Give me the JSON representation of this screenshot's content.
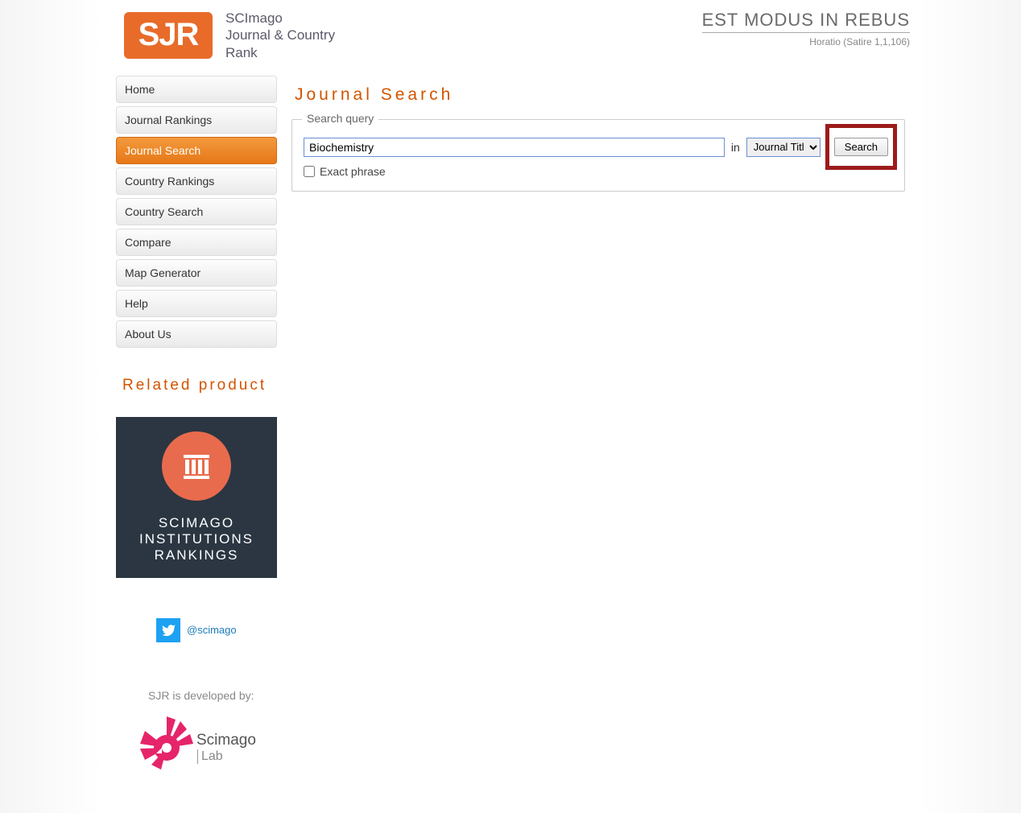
{
  "header": {
    "logo_abbr": "SJR",
    "logo_line1": "SCImago",
    "logo_line2": "Journal & Country",
    "logo_line3": "Rank",
    "motto": "EST MODUS IN REBUS",
    "motto_sub": "Horatio (Satire 1,1,106)"
  },
  "sidebar": {
    "items": [
      {
        "label": "Home",
        "active": false
      },
      {
        "label": "Journal Rankings",
        "active": false
      },
      {
        "label": "Journal Search",
        "active": true
      },
      {
        "label": "Country Rankings",
        "active": false
      },
      {
        "label": "Country Search",
        "active": false
      },
      {
        "label": "Compare",
        "active": false
      },
      {
        "label": "Map Generator",
        "active": false
      },
      {
        "label": "Help",
        "active": false
      },
      {
        "label": "About Us",
        "active": false
      }
    ],
    "related_title": "Related product",
    "promo_line1": "SCIMAGO",
    "promo_line2": "INSTITUTIONS",
    "promo_line3": "RANKINGS",
    "twitter_handle": "@scimago",
    "dev_by": "SJR is developed by:",
    "lab_name": "Scimago",
    "lab_sub": "Lab"
  },
  "main": {
    "page_title": "Journal Search",
    "fieldset_legend": "Search query",
    "search_value": "Biochemistry",
    "in_label": "in",
    "select_value": "Journal Title",
    "search_button": "Search",
    "exact_label": "Exact phrase"
  }
}
